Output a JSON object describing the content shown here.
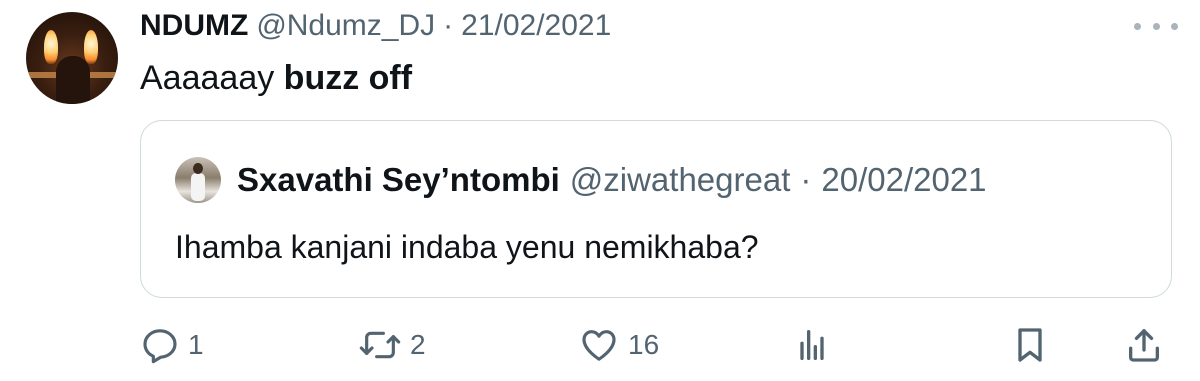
{
  "tweet": {
    "display_name": "NDUMZ",
    "handle": "@Ndumz_DJ",
    "separator": "·",
    "date": "21/02/2021",
    "text_plain": "Aaaaaay ",
    "text_bold": "buzz off"
  },
  "quoted_tweet": {
    "display_name": "Sxavathi Sey’ntombi",
    "handle": "@ziwathegreat",
    "separator": "·",
    "date": "20/02/2021",
    "text": "Ihamba kanjani indaba yenu nemikhaba?"
  },
  "actions": {
    "reply_count": "1",
    "retweet_count": "2",
    "like_count": "16"
  },
  "icons": {
    "more": "more-horizontal-icon",
    "reply": "reply-icon",
    "retweet": "retweet-icon",
    "like": "heart-icon",
    "views": "views-icon",
    "bookmark": "bookmark-icon",
    "share": "share-icon"
  },
  "colors": {
    "text": "#0f1419",
    "secondary": "#536471",
    "border": "#cfd9de"
  }
}
